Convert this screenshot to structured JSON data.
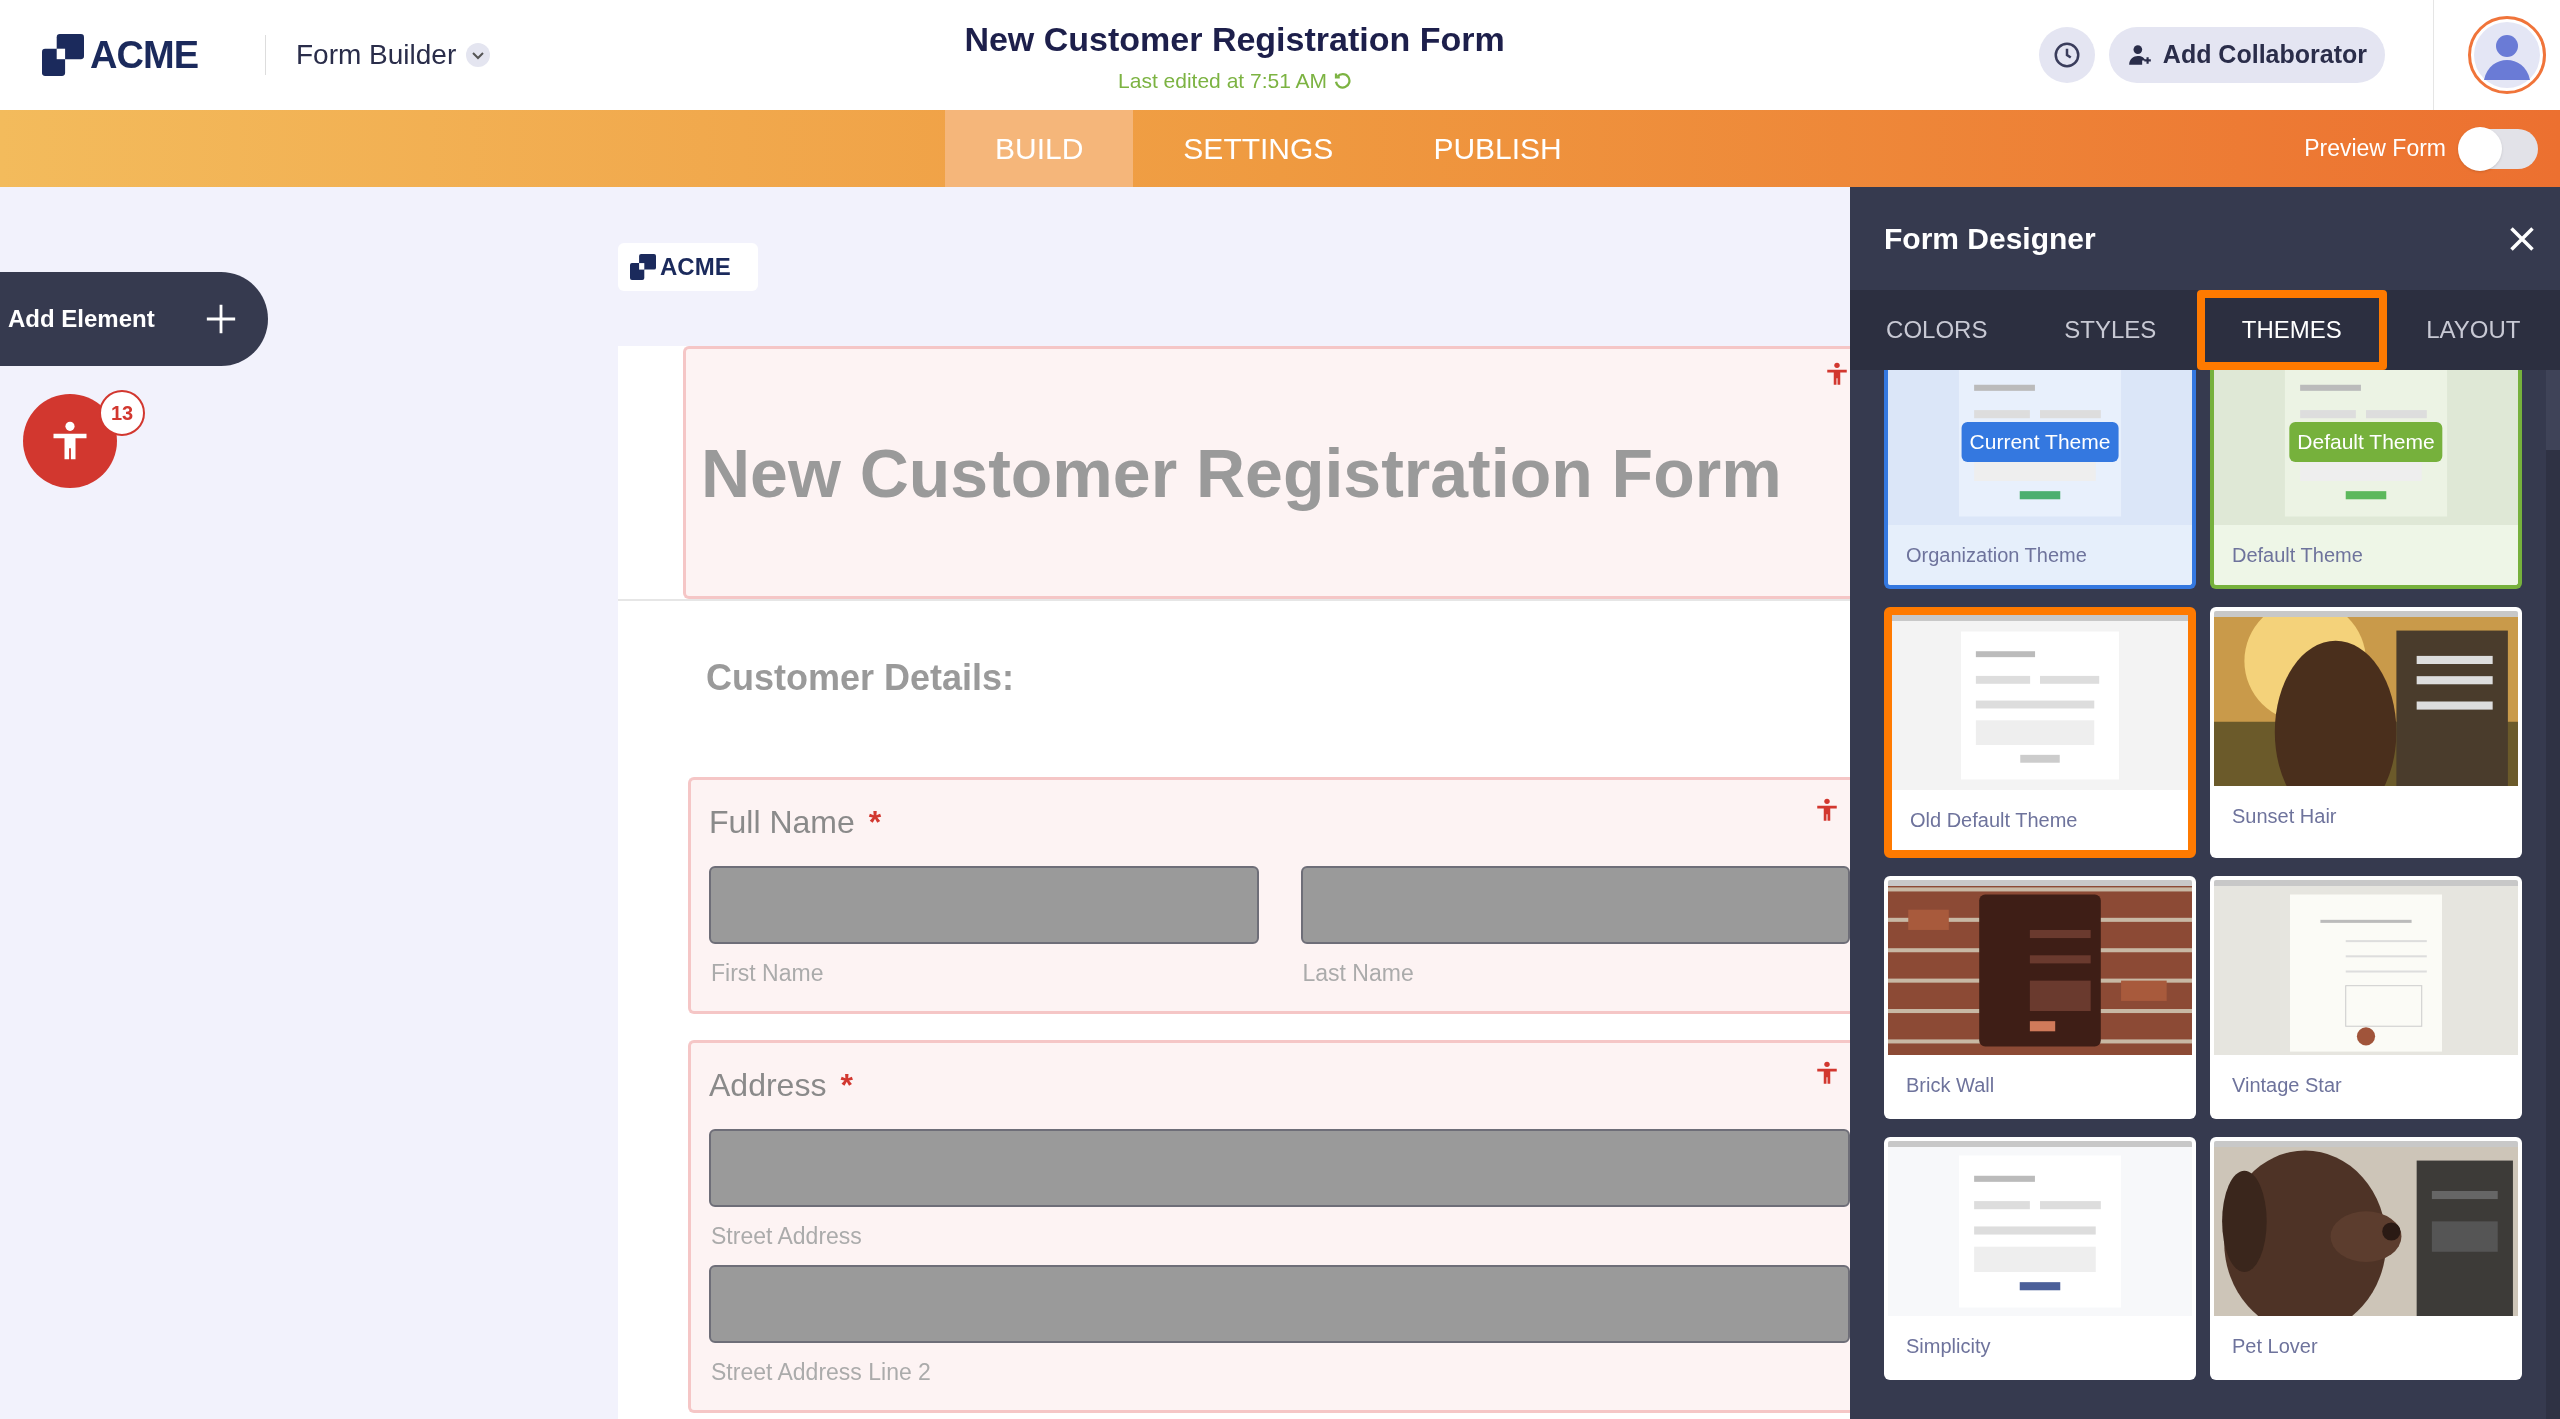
{
  "header": {
    "logo": "ACME",
    "app_menu": "Form Builder",
    "title": "New Customer Registration Form",
    "last_edited": "Last edited at 7:51 AM",
    "collaborator_button": "Add Collaborator"
  },
  "nav": {
    "tabs": [
      {
        "label": "BUILD",
        "selected": true
      },
      {
        "label": "SETTINGS",
        "selected": false
      },
      {
        "label": "PUBLISH",
        "selected": false
      }
    ],
    "preview": {
      "label": "Preview Form",
      "on": false
    }
  },
  "sidebar": {
    "add_element": "Add Element",
    "accessibility_count": "13"
  },
  "form": {
    "logo": "ACME",
    "title": "New Customer Registration Form",
    "section_heading": "Customer Details:",
    "fields": [
      {
        "label": "Full Name",
        "required": "*",
        "inputs": [
          [
            "First Name",
            "Last Name"
          ]
        ]
      },
      {
        "label": "Address",
        "required": "*",
        "inputs": [
          [
            "Street Address"
          ],
          [
            "Street Address Line 2"
          ]
        ]
      }
    ]
  },
  "designer": {
    "title": "Form Designer",
    "tabs": [
      {
        "label": "COLORS",
        "selected": false
      },
      {
        "label": "STYLES",
        "selected": false
      },
      {
        "label": "THEMES",
        "selected": true
      },
      {
        "label": "LAYOUT",
        "selected": false
      }
    ],
    "themes": [
      {
        "name": "Organization Theme",
        "badge": "Current Theme",
        "color": "#3478e0",
        "selected": false
      },
      {
        "name": "Default Theme",
        "badge": "Default Theme",
        "color": "#76b13c",
        "selected": false
      },
      {
        "name": "Old Default Theme",
        "selected": true
      },
      {
        "name": "Sunset Hair",
        "selected": false
      },
      {
        "name": "Brick Wall",
        "selected": false
      },
      {
        "name": "Vintage Star",
        "selected": false
      },
      {
        "name": "Simplicity",
        "selected": false
      },
      {
        "name": "Pet Lover",
        "selected": false
      }
    ]
  }
}
